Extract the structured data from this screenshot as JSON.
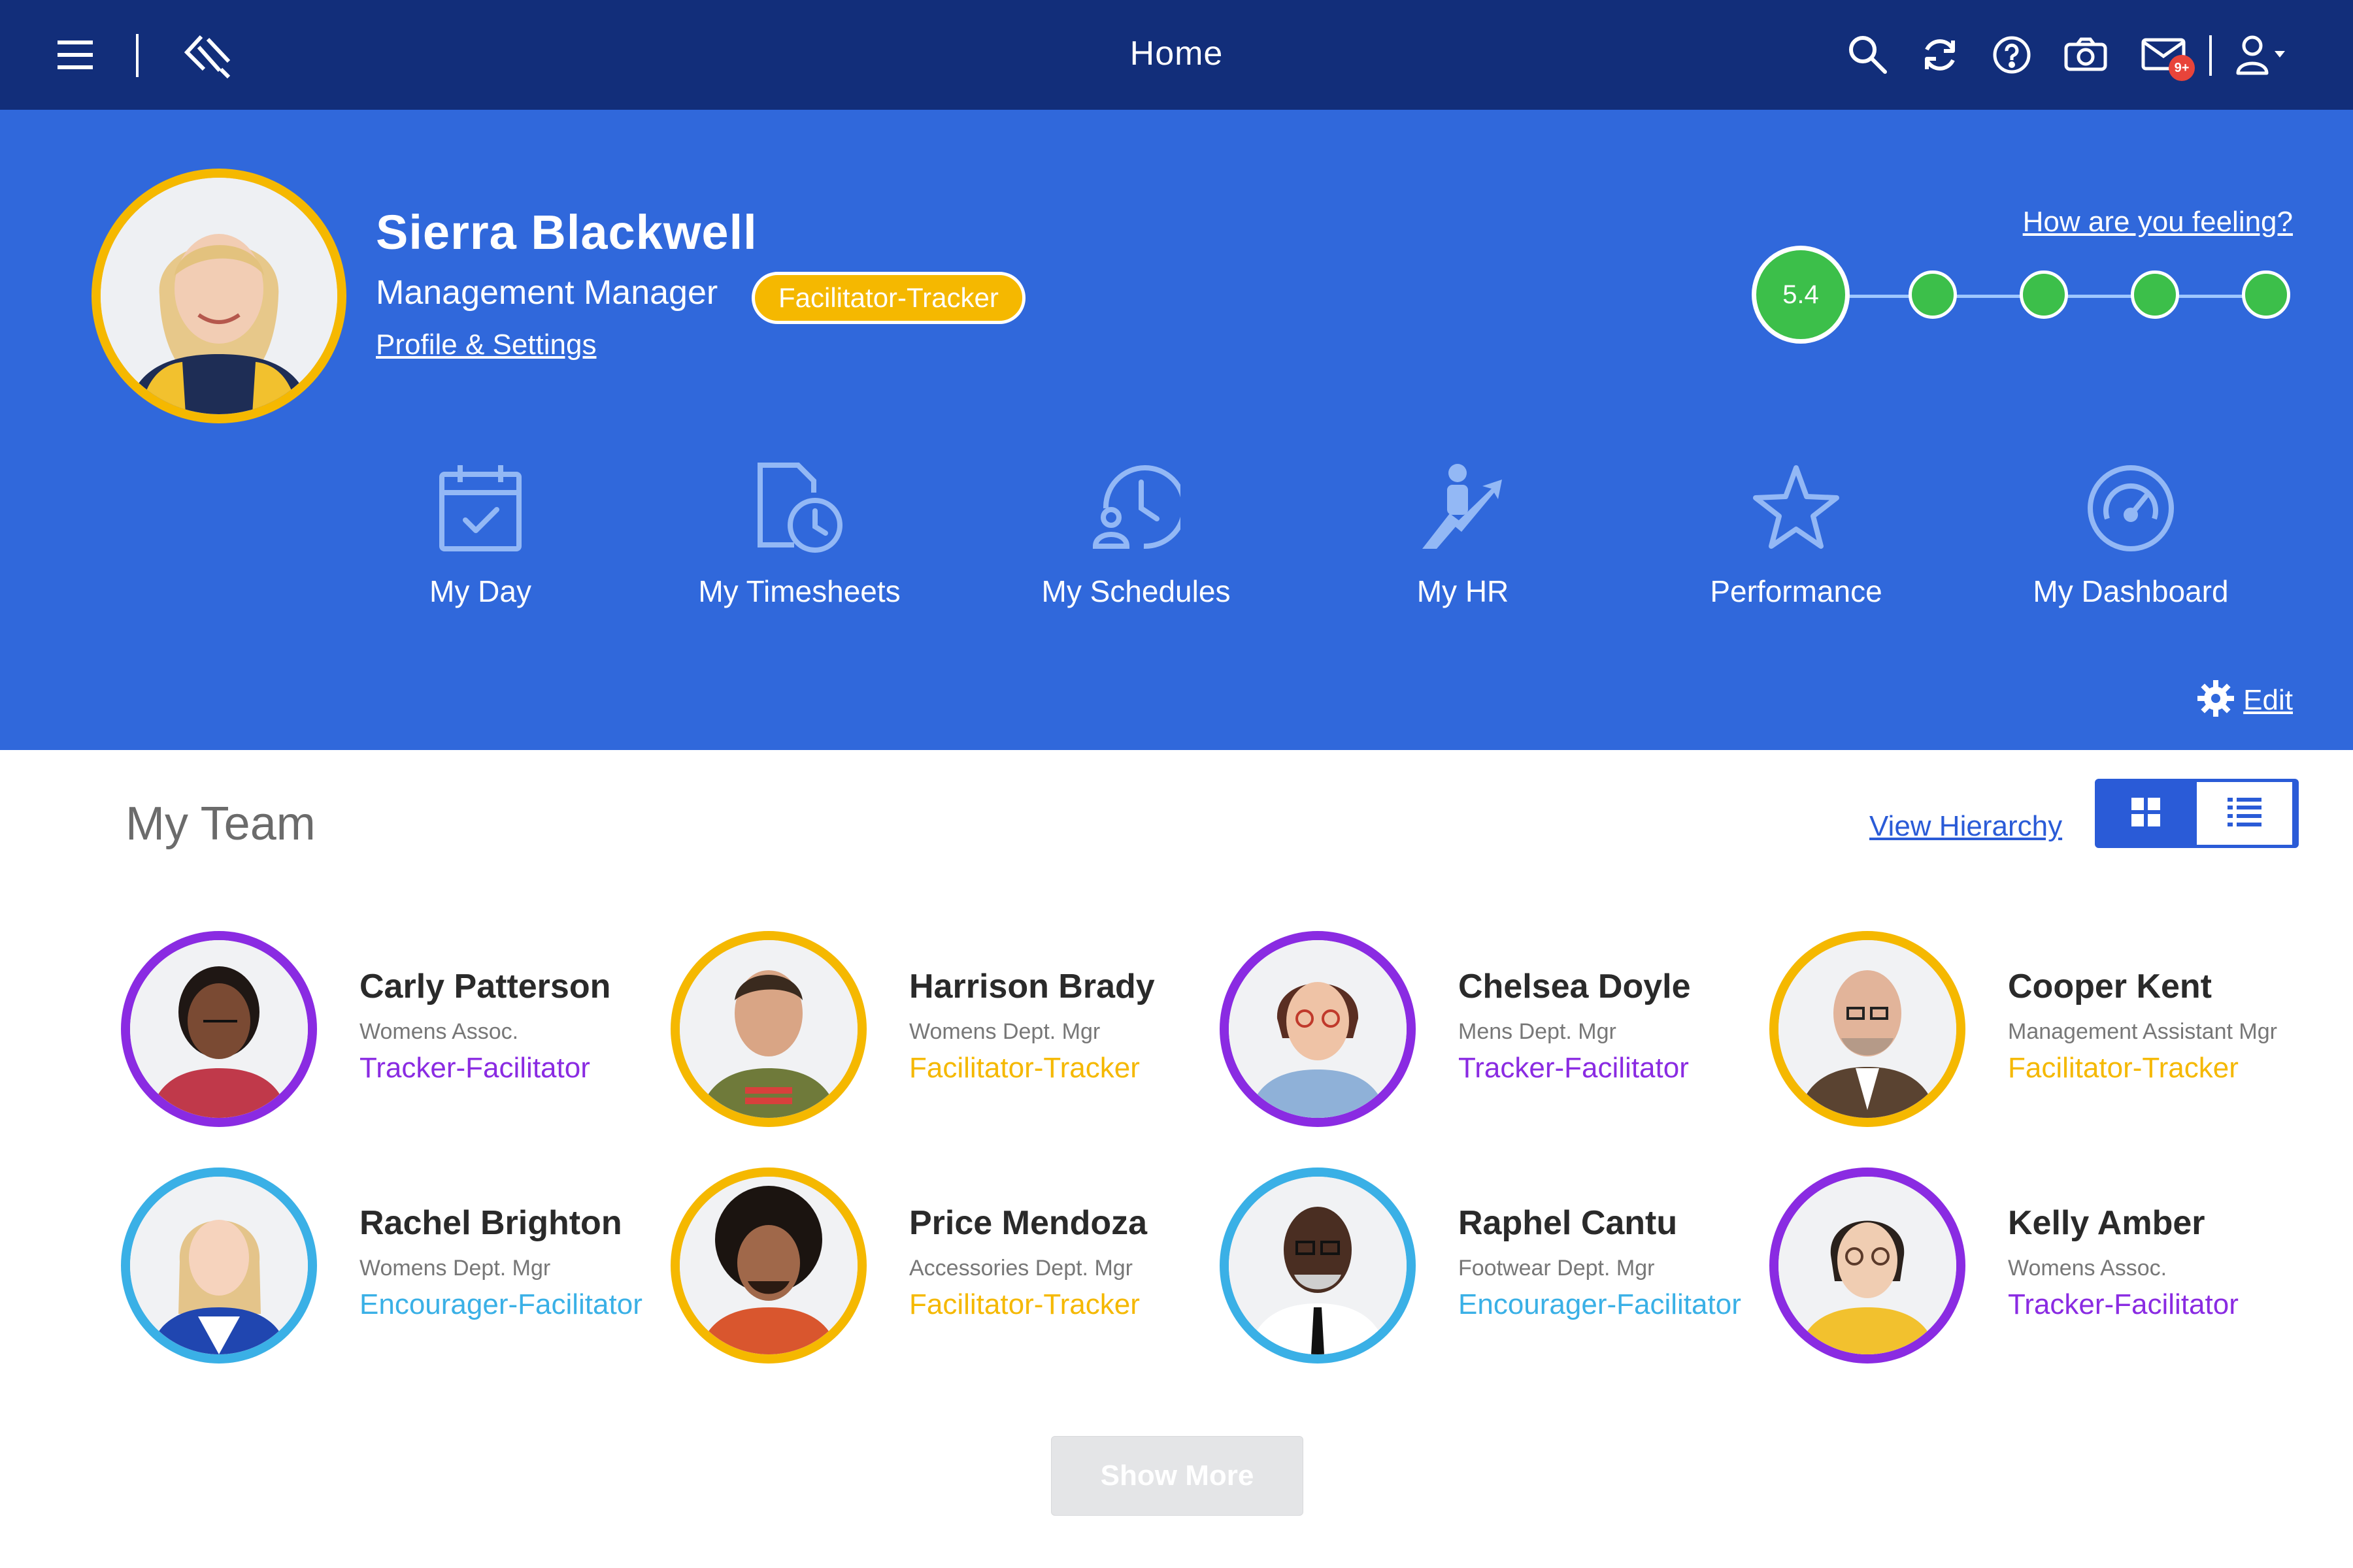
{
  "topbar": {
    "title": "Home",
    "notification_badge": "9+"
  },
  "user": {
    "name": "Sierra Blackwell",
    "role": "Management Manager",
    "type_badge": "Facilitator-Tracker",
    "profile_link": "Profile & Settings",
    "feeling_link": "How are you feeling?",
    "mood_score": "5.4"
  },
  "quick_links": [
    {
      "label": "My Day",
      "icon": "calendar-check-icon"
    },
    {
      "label": "My Timesheets",
      "icon": "timesheet-clock-icon"
    },
    {
      "label": "My Schedules",
      "icon": "schedule-person-icon"
    },
    {
      "label": "My HR",
      "icon": "person-growth-icon"
    },
    {
      "label": "Performance",
      "icon": "star-icon"
    },
    {
      "label": "My Dashboard",
      "icon": "gauge-icon"
    }
  ],
  "edit_label": "Edit",
  "team": {
    "title": "My Team",
    "view_hierarchy": "View Hierarchy",
    "show_more": "Show More",
    "members": [
      {
        "name": "Carly Patterson",
        "position": "Womens Assoc.",
        "type": "Tracker-Facilitator",
        "color": "#8a2be2"
      },
      {
        "name": "Harrison Brady",
        "position": "Womens Dept. Mgr",
        "type": "Facilitator-Tracker",
        "color": "#f5b800"
      },
      {
        "name": "Chelsea Doyle",
        "position": "Mens Dept. Mgr",
        "type": "Tracker-Facilitator",
        "color": "#8a2be2"
      },
      {
        "name": "Cooper Kent",
        "position": "Management Assistant Mgr",
        "type": "Facilitator-Tracker",
        "color": "#f5b800"
      },
      {
        "name": "Rachel Brighton",
        "position": "Womens Dept. Mgr",
        "type": "Encourager-Facilitator",
        "color": "#3ab0e6"
      },
      {
        "name": "Price Mendoza",
        "position": "Accessories Dept. Mgr",
        "type": "Facilitator-Tracker",
        "color": "#f5b800"
      },
      {
        "name": "Raphel Cantu",
        "position": "Footwear Dept. Mgr",
        "type": "Encourager-Facilitator",
        "color": "#3ab0e6"
      },
      {
        "name": "Kelly Amber",
        "position": "Womens Assoc.",
        "type": "Tracker-Facilitator",
        "color": "#8a2be2"
      }
    ]
  },
  "colors": {
    "topbar": "#122e7a",
    "hero": "#3068db",
    "accent_blue": "#2a5bd7",
    "mood_green": "#3cbf4a",
    "tracker_purple": "#8a2be2",
    "facilitator_yellow": "#f5b800",
    "encourager_cyan": "#3ab0e6"
  }
}
